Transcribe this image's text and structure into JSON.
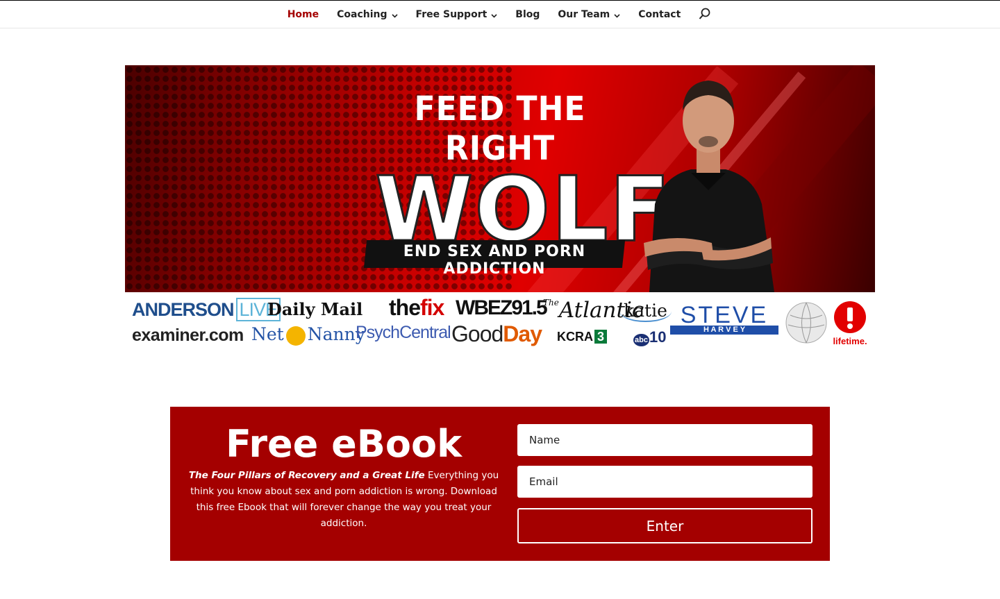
{
  "nav": {
    "items": [
      {
        "label": "Home",
        "active": true,
        "dropdown": false
      },
      {
        "label": "Coaching",
        "active": false,
        "dropdown": true
      },
      {
        "label": "Free Support",
        "active": false,
        "dropdown": true
      },
      {
        "label": "Blog",
        "active": false,
        "dropdown": false
      },
      {
        "label": "Our Team",
        "active": false,
        "dropdown": true
      },
      {
        "label": "Contact",
        "active": false,
        "dropdown": false
      }
    ],
    "chevron": "⌄",
    "search_icon": "search-icon"
  },
  "banner": {
    "line1": "FEED THE RIGHT",
    "line2": "WOLF",
    "tagline": "END SEX AND PORN ADDICTION"
  },
  "logos": {
    "anderson": "ANDERSON",
    "live": "LIVE",
    "daily_mail": "Daily Mail",
    "the": "the",
    "fix": "fix",
    "wbez": "WBEZ91.5",
    "the_small": "The",
    "atlantic": "Atlantic",
    "katie": "katie",
    "steve": "STEVE",
    "harvey": "H A R V E Y",
    "examiner": "examiner.com",
    "net": "Net",
    "nanny": "Nanny",
    "psychcentral": "PsychCentral",
    "good": "Good",
    "day": "Day",
    "kcra": "KCRA",
    "kcra_num": "3",
    "abc": "abc",
    "abc_num": "10",
    "lifetime": "lifetime."
  },
  "ebook": {
    "title": "Free eBook",
    "desc_emphasis": "The Four Pillars of Recovery and a Great Life",
    "desc_body": " Everything you think you know about sex and porn addiction is wrong. Download this free Ebook that will forever change the way you treat your addiction.",
    "name_placeholder": "Name",
    "email_placeholder": "Email",
    "button_label": "Enter"
  },
  "colors": {
    "brand_red": "#a40000",
    "active_nav": "#a40000"
  }
}
